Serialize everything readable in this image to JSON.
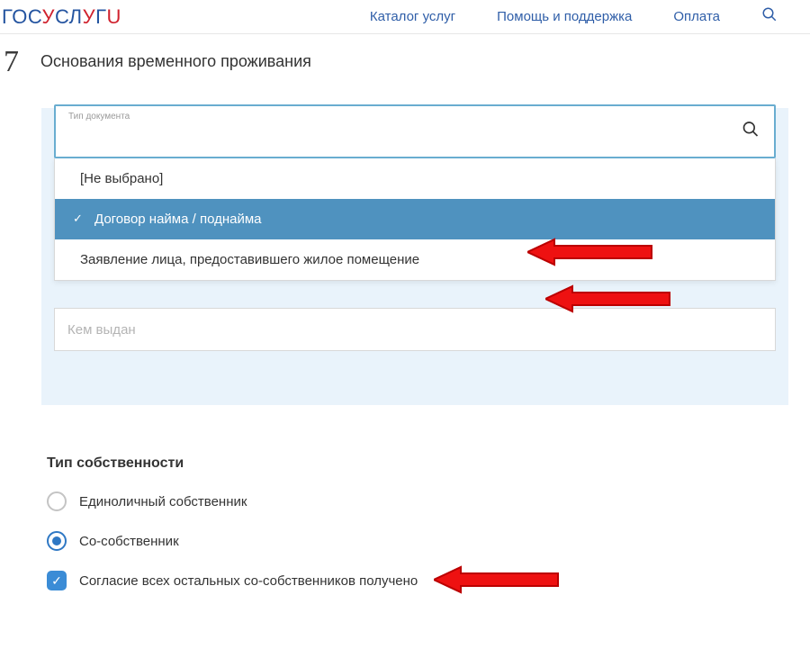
{
  "header": {
    "logo_parts": [
      "Г",
      "О",
      "С",
      "У",
      "С",
      "Л",
      "У",
      "Г",
      "U"
    ],
    "nav": {
      "catalog": "Каталог услуг",
      "help": "Помощь и поддержка",
      "pay": "Оплата"
    }
  },
  "step": {
    "number": "7",
    "title": "Основания временного проживания"
  },
  "doc_select": {
    "label": "Тип документа",
    "options": {
      "none": "[Не выбрано]",
      "lease": "Договор найма / поднайма",
      "statement": "Заявление лица, предоставившего жилое помещение"
    }
  },
  "issued_by": {
    "placeholder": "Кем выдан"
  },
  "ownership": {
    "title": "Тип собственности",
    "sole": "Единоличный собственник",
    "co": "Со-собственник",
    "consent": "Согласие всех остальных со-собственников получено"
  }
}
